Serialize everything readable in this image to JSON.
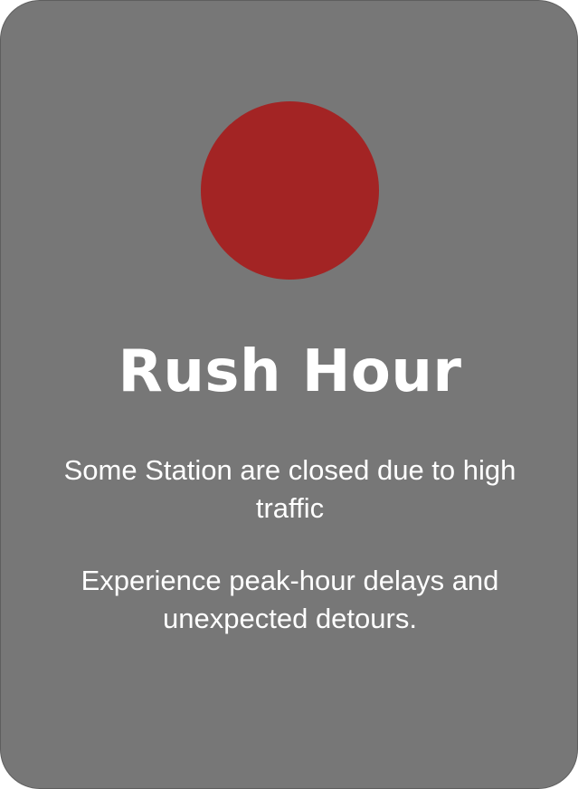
{
  "card": {
    "status_color": "#a32424",
    "background_color": "#777777",
    "title": "Rush Hour",
    "paragraphs": [
      "Some Station are closed due to high traffic",
      "Experience peak-hour delays and unexpected detours."
    ]
  }
}
